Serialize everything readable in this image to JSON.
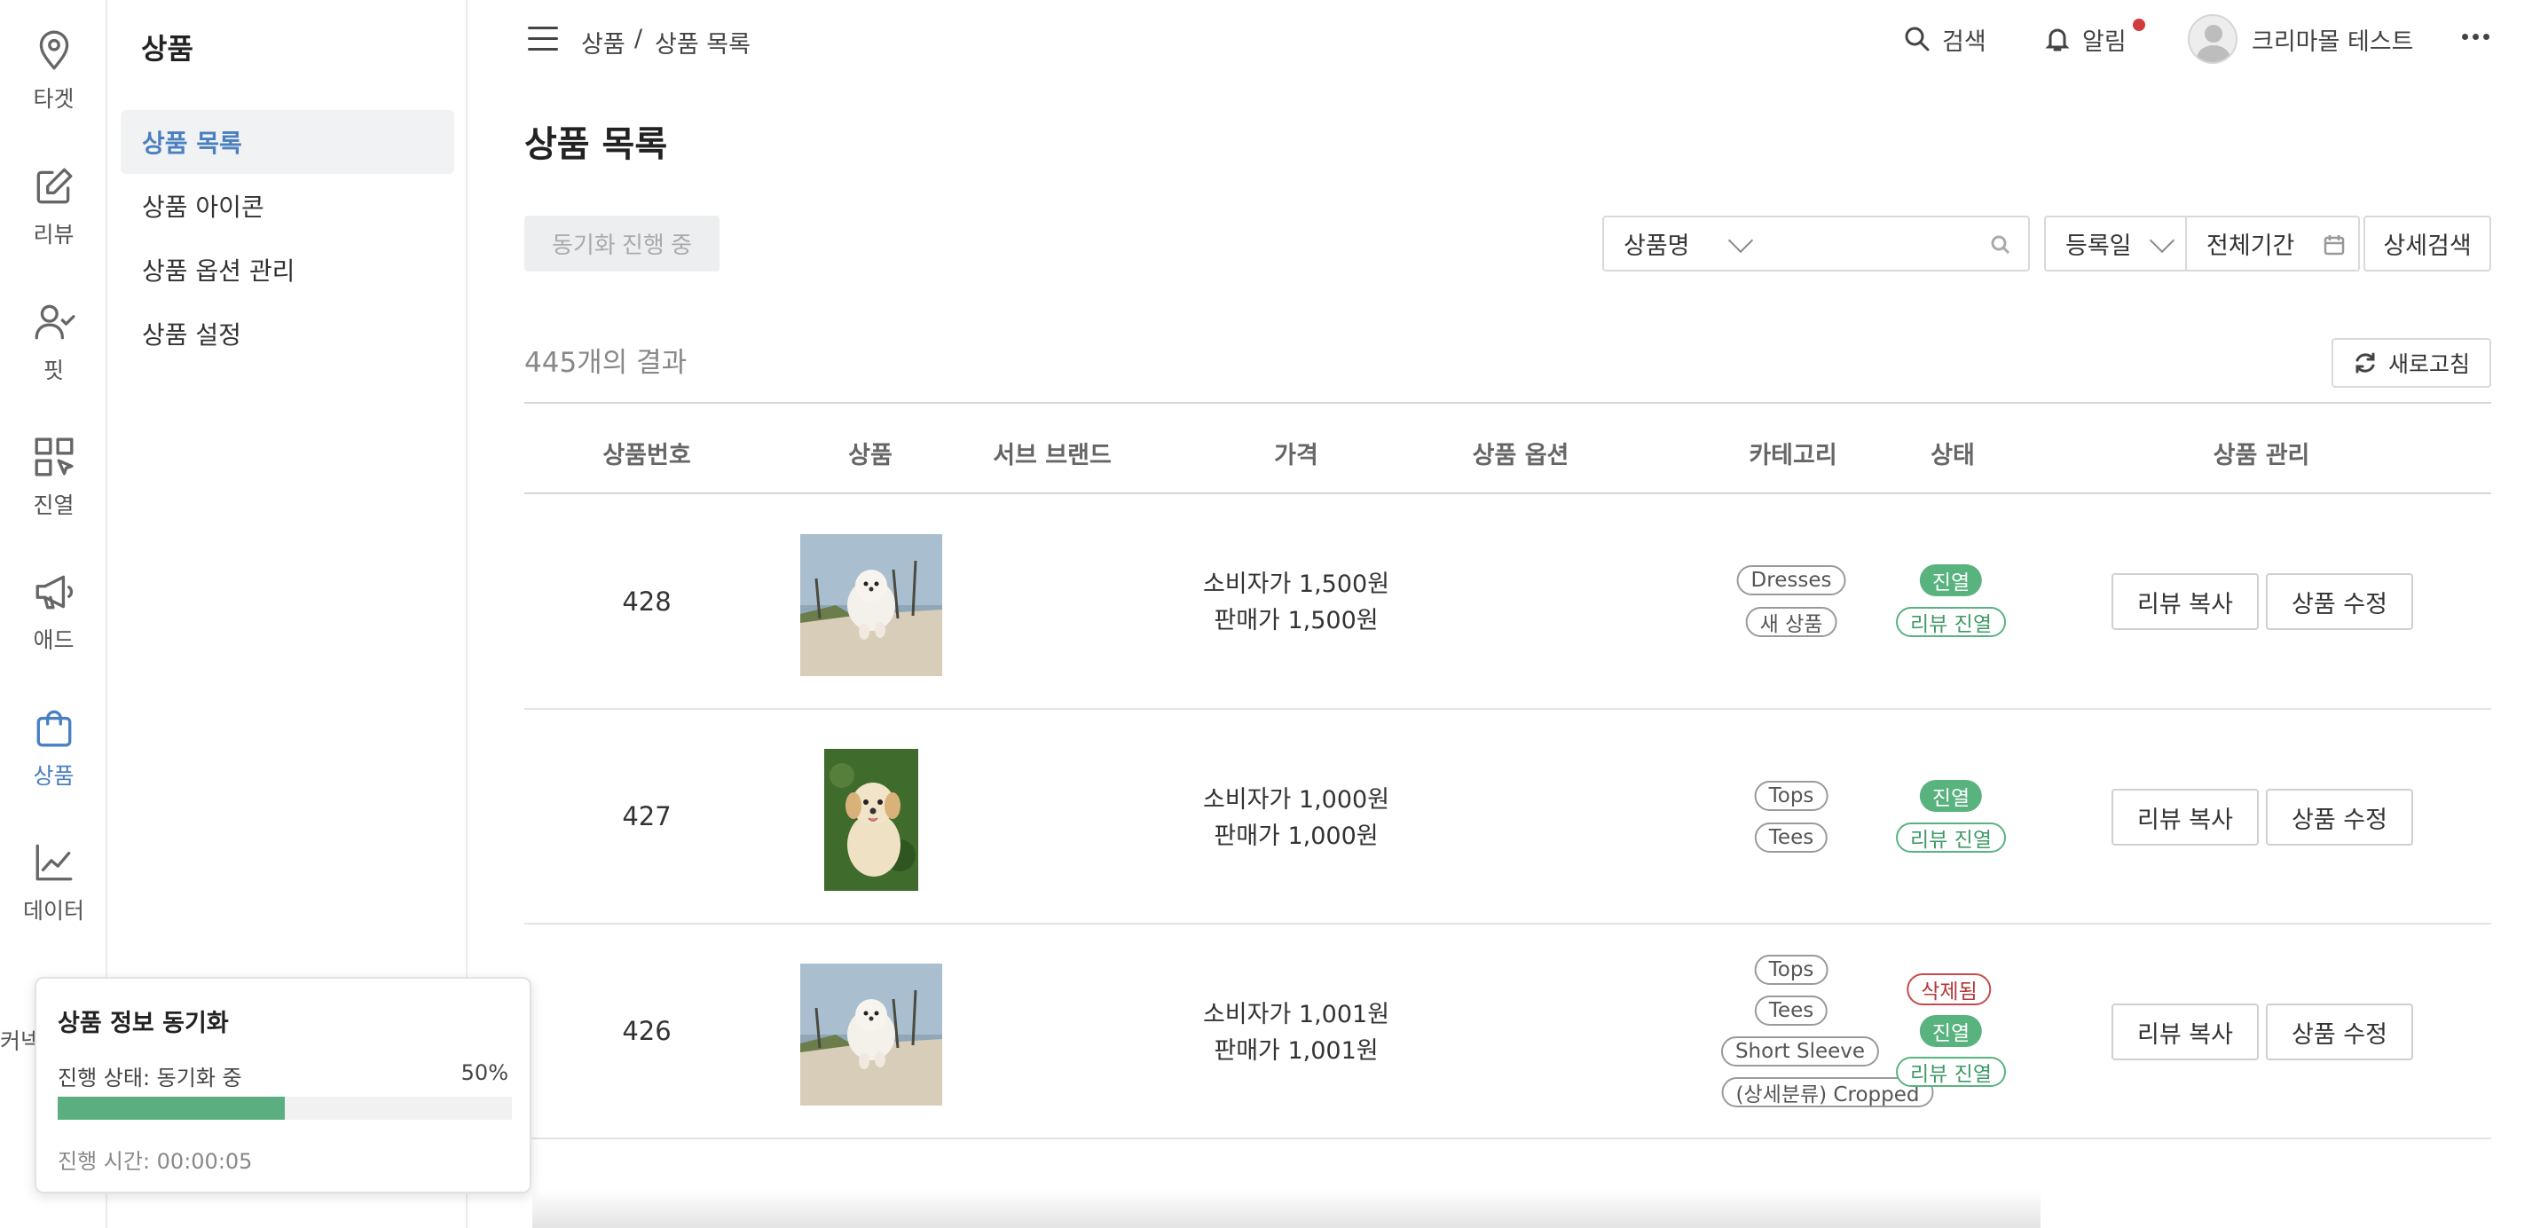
{
  "rail": {
    "items": [
      {
        "label": "타겟",
        "icon": "location-pin-icon"
      },
      {
        "label": "리뷰",
        "icon": "edit-icon"
      },
      {
        "label": "핏",
        "icon": "user-check-icon"
      },
      {
        "label": "진열",
        "icon": "grid-cursor-icon"
      },
      {
        "label": "애드",
        "icon": "megaphone-icon"
      },
      {
        "label": "상품",
        "icon": "shopping-bag-icon",
        "active": true
      },
      {
        "label": "데이터",
        "icon": "line-chart-icon"
      }
    ],
    "partial_label": "커넥"
  },
  "subnav": {
    "title": "상품",
    "items": [
      {
        "label": "상품 목록",
        "active": true
      },
      {
        "label": "상품 아이콘"
      },
      {
        "label": "상품 옵션 관리"
      },
      {
        "label": "상품 설정"
      }
    ]
  },
  "topbar": {
    "breadcrumb": [
      "상품",
      "/",
      "상품 목록"
    ],
    "search_label": "검색",
    "notification_label": "알림",
    "user_name": "크리마몰 테스트"
  },
  "main": {
    "title": "상품 목록",
    "sync_button": "동기화 진행 중",
    "filter_field": "상품명",
    "search_placeholder": "",
    "date_field": "등록일",
    "date_range": "전체기간",
    "advanced_search": "상세검색",
    "result_count": "445개의 결과",
    "refresh_label": "새로고침"
  },
  "table": {
    "columns": [
      "상품번호",
      "상품",
      "서브 브랜드",
      "가격",
      "상품 옵션",
      "카테고리",
      "상태",
      "상품 관리"
    ],
    "rows": [
      {
        "id": "428",
        "image": "pomeranian-running-photo",
        "sub_brand": "",
        "price_consumer": "소비자가 1,500원",
        "price_sale": "판매가 1,500원",
        "options": "",
        "categories": [
          "Dresses",
          "새 상품"
        ],
        "statuses": [
          "진열",
          "리뷰 진열"
        ],
        "actions": [
          "리뷰 복사",
          "상품 수정"
        ]
      },
      {
        "id": "427",
        "image": "golden-puppy-photo",
        "sub_brand": "",
        "price_consumer": "소비자가 1,000원",
        "price_sale": "판매가 1,000원",
        "options": "",
        "categories": [
          "Tops",
          "Tees"
        ],
        "statuses": [
          "진열",
          "리뷰 진열"
        ],
        "actions": [
          "리뷰 복사",
          "상품 수정"
        ]
      },
      {
        "id": "426",
        "image": "pomeranian-running-photo",
        "sub_brand": "",
        "price_consumer": "소비자가 1,001원",
        "price_sale": "판매가 1,001원",
        "options": "",
        "categories": [
          "Tops",
          "Tees",
          "Short Sleeve",
          "(상세분류) Cropped"
        ],
        "statuses": [
          "삭제됨",
          "진열",
          "리뷰 진열"
        ],
        "actions": [
          "리뷰 복사",
          "상품 수정"
        ]
      }
    ]
  },
  "sync_popup": {
    "title": "상품 정보 동기화",
    "status_text": "진행 상태: 동기화 중",
    "percent_text": "50%",
    "progress": 0.5,
    "elapsed_text": "진행 시간: 00:00:05"
  },
  "colors": {
    "accent": "#4a7fc1",
    "green": "#58b37f",
    "red": "#c54a4a"
  }
}
